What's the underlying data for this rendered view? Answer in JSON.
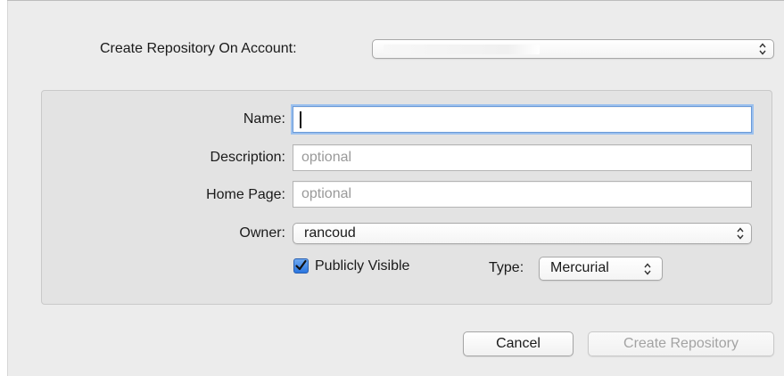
{
  "account": {
    "label": "Create Repository On Account:",
    "selected_value": ""
  },
  "form": {
    "name_label": "Name:",
    "name_value": "",
    "description_label": "Description:",
    "description_placeholder": "optional",
    "homepage_label": "Home Page:",
    "homepage_placeholder": "optional",
    "owner_label": "Owner:",
    "owner_value": "rancoud",
    "public_label": "Publicly Visible",
    "public_checked": true,
    "type_label": "Type:",
    "type_value": "Mercurial"
  },
  "actions": {
    "cancel_label": "Cancel",
    "create_label": "Create Repository"
  },
  "colors": {
    "accent": "#2b76e0",
    "focus_ring": "#9cc1ee",
    "disabled_text": "#a3a3a3"
  },
  "icons": {
    "popup_arrows": "chevron-up-down-icon",
    "checkmark": "checkmark-icon"
  }
}
